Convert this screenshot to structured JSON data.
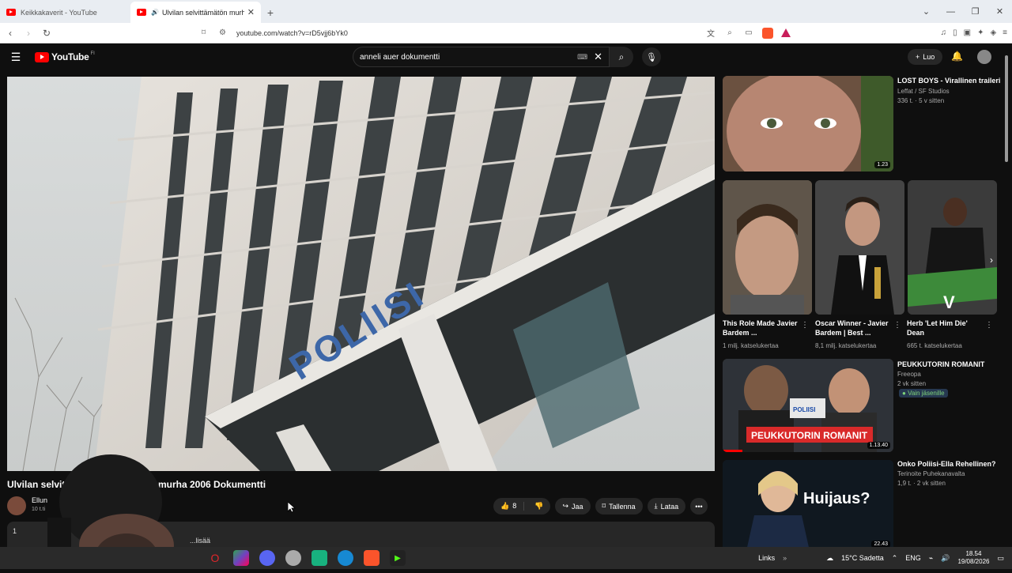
{
  "browser": {
    "tabs": [
      {
        "label": "Keikkakaverit - YouTube",
        "active": false
      },
      {
        "label": "Ulvilan selvittämätön murha",
        "active": true
      }
    ],
    "url": "youtube.com/watch?v=rD5vjj6bYk0",
    "window_controls": [
      "⌄",
      "—",
      "❐",
      "✕"
    ]
  },
  "youtube": {
    "logo_text": "YouTube",
    "logo_sup": "FI",
    "search_value": "anneli auer dokumentti",
    "create_label": "Luo"
  },
  "video": {
    "title_left": "Ulvilan selvit",
    "title_right": "murha 2006 Dokumentti",
    "building_text": "POLIISI",
    "channel_name": "Ellun",
    "channel_subs": "10 t.ti",
    "likes": "8",
    "share_label": "Jaa",
    "save_label": "Tallenna",
    "download_label": "Lataa",
    "desc_num": "1",
    "desc_more": "...lisää"
  },
  "recommendations": {
    "top": {
      "title": "LOST BOYS - Virallinen traileri",
      "channel": "Leffat / SF Studios",
      "meta": "336 t. · 5 v sitten",
      "duration": "1.23"
    },
    "shorts": [
      {
        "title": "This Role Made Javier Bardem ...",
        "views": "1 milj. katselukertaa"
      },
      {
        "title": "Oscar Winner - Javier Bardem | Best ...",
        "views": "8,1 milj. katselukertaa"
      },
      {
        "title": "Herb 'Let Him Die' Dean",
        "views": "665 t. katselukertaa",
        "overlay_letter": "V"
      }
    ],
    "third": {
      "title": "PEUKKUTORIN ROMANIT",
      "channel": "Freeopa",
      "meta": "2 vk sitten",
      "badge": "Vain jäsenille",
      "thumb_caption": "PEUKKUTORIN ROMANIT",
      "duration": "1.13.40",
      "overlay": "POLIISI"
    },
    "fourth": {
      "title": "Onko Poliisi-Ella Rehellinen?",
      "channel": "Terinoite Puhekanavalta",
      "meta": "1,9 t. · 2 vk sitten",
      "thumb_caption": "Huijaus?",
      "duration": "22.43"
    }
  },
  "taskbar": {
    "links_label": "Links",
    "weather": "15°C  Sadetta",
    "lang": "ENG",
    "time": "18.54",
    "date": "19/08/2026"
  },
  "colors": {
    "yt_red": "#ff0000",
    "bg": "#0f0f0f",
    "member_green": "#3ea6ff"
  }
}
